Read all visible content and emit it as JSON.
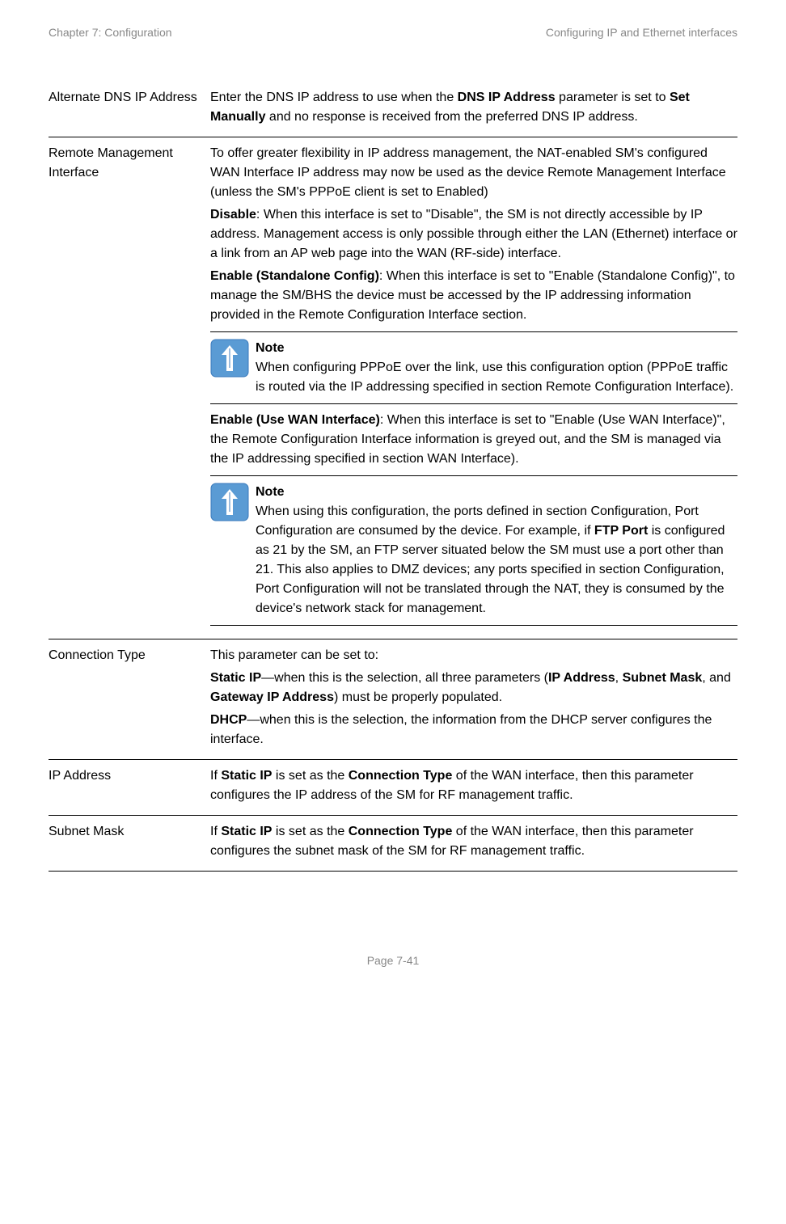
{
  "header": {
    "left": "Chapter 7:  Configuration",
    "right": "Configuring IP and Ethernet interfaces"
  },
  "rows": {
    "altDns": {
      "name": "Alternate DNS IP Address",
      "d1a": "Enter the DNS IP address to use when the ",
      "d1b": "DNS IP Address",
      "d1c": " parameter is set to ",
      "d1d": "Set Manually",
      "d1e": " and no response is received from the preferred DNS IP address."
    },
    "remote": {
      "name": "Remote Management Interface",
      "p1": "To offer greater flexibility in IP address management, the NAT-enabled SM's configured WAN Interface IP address may now be used as the device Remote Management Interface (unless the SM's PPPoE client is set to Enabled)",
      "p2a": "Disable",
      "p2b": ": When this interface is set to \"Disable\", the SM is not directly accessible by IP address. Management access is only possible through either the LAN (Ethernet) interface or a link from an AP web page into the WAN (RF-side) interface.",
      "p3a": "Enable (Standalone Config)",
      "p3b": ": When this interface is set to \"Enable (Standalone Config)\", to manage the SM/BHS the device must be accessed by the IP addressing information provided in the Remote Configuration Interface section.",
      "note1Title": "Note",
      "note1Body": "When configuring PPPoE over the link, use this configuration option (PPPoE traffic is routed via the IP addressing specified in section Remote Configuration Interface).",
      "p4a": "Enable (Use WAN Interface)",
      "p4b": ": When this interface is set to \"Enable (Use WAN Interface)\", the Remote Configuration Interface information is greyed out, and the SM is managed via the IP addressing specified in section WAN Interface).",
      "note2Title": "Note",
      "note2BodyA": "When using this configuration, the ports defined in section Configuration, Port Configuration are consumed by the device. For example, if ",
      "note2BodyB": "FTP Port",
      "note2BodyC": " is configured as 21 by the SM, an FTP server situated below the SM must use a port other than 21. This also applies to DMZ devices; any ports specified in section Configuration, Port Configuration will not be translated through the NAT, they is consumed by the device's network stack for management."
    },
    "connType": {
      "name": "Connection Type",
      "p1": "This parameter can be set to:",
      "p2a": "Static IP",
      "p2b": "—when this is the selection, all three parameters (",
      "p2c": "IP Address",
      "p2d": ", ",
      "p2e": "Subnet Mask",
      "p2f": ", and ",
      "p2g": "Gateway IP Address",
      "p2h": ") must be properly populated.",
      "p3a": "DHCP",
      "p3b": "—when this is the selection, the information from the DHCP server configures the interface."
    },
    "ipAddr": {
      "name": "IP Address",
      "d1a": "If ",
      "d1b": "Static IP",
      "d1c": " is set as the ",
      "d1d": "Connection Type",
      "d1e": " of the WAN interface, then this parameter configures the IP address of the SM for RF management traffic."
    },
    "subnet": {
      "name": "Subnet Mask",
      "d1a": "If ",
      "d1b": "Static IP",
      "d1c": " is set as the ",
      "d1d": "Connection Type",
      "d1e": " of the WAN interface, then this parameter configures the subnet mask of the SM for RF management traffic."
    }
  },
  "footer": "Page 7-41"
}
